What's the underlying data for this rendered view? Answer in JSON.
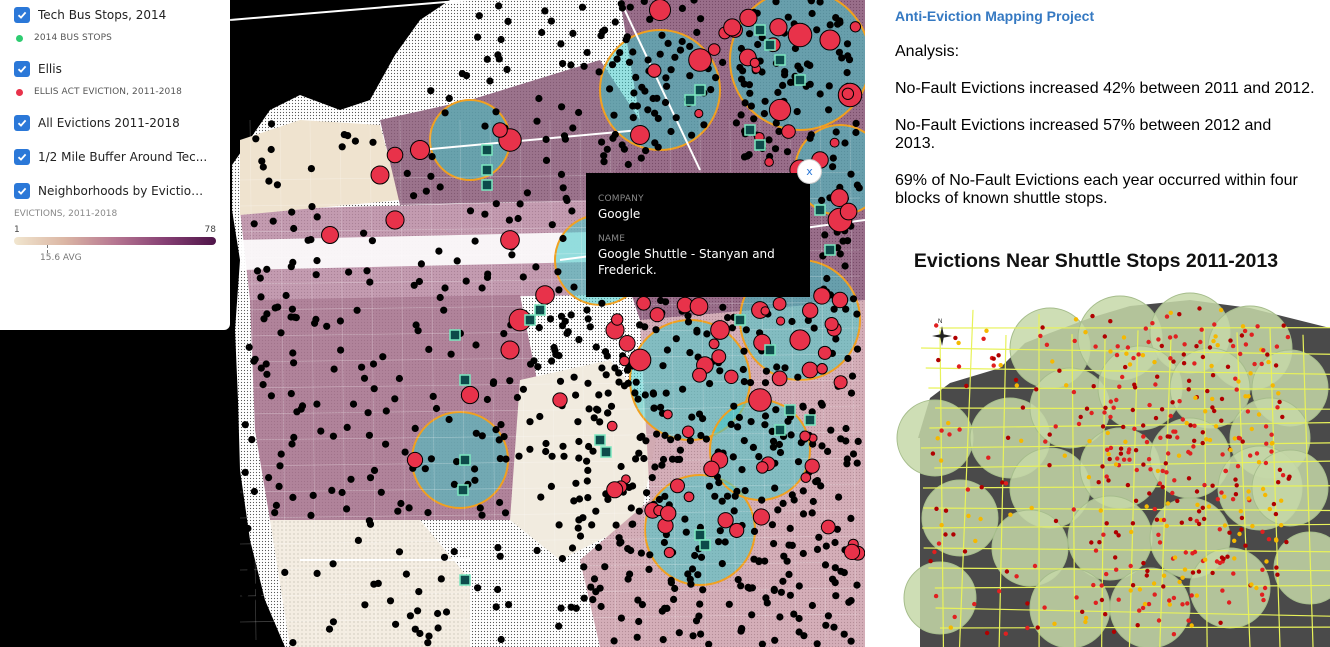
{
  "legend": {
    "layers": [
      {
        "label": "Tech Bus Stops, 2014",
        "checked": true,
        "sublabel": "2014 BUS STOPS",
        "swatch": "#2ecc71"
      },
      {
        "label": "Ellis",
        "checked": true,
        "sublabel": "ELLIS ACT EVICTION, 2011-2018",
        "swatch": "#e8324a"
      },
      {
        "label": "All Evictions 2011-2018",
        "checked": true
      },
      {
        "label": "1/2 Mile Buffer Around Tec...",
        "checked": true
      },
      {
        "label": "Neighborhoods by Eviction ...",
        "checked": true
      }
    ],
    "ramp": {
      "title": "EVICTIONS, 2011-2018",
      "min": "1",
      "max": "78",
      "avg_label": "15.6 AVG"
    }
  },
  "popup": {
    "fields": [
      {
        "key": "COMPANY",
        "value": "Google"
      },
      {
        "key": "NAME",
        "value": "Google Shuttle - Stanyan and Frederick."
      }
    ],
    "close_label": "x"
  },
  "side": {
    "link": "Anti-Eviction Mapping Project",
    "analysis": "Analysis:",
    "paragraphs": [
      "No-Fault Evictions increased 42% between 2011 and 2012.",
      "No-Fault Evictions increased 57% between 2012 and 2013.",
      "69% of No-Fault Evictions each year occurred within four blocks of known shuttle stops."
    ],
    "figure_title": "Evictions Near Shuttle Stops 2011-2013",
    "compass_label": "N"
  },
  "colors": {
    "checkbox": "#2b78d8",
    "bus_stop": "#2ecc71",
    "ellis": "#e8324a",
    "eviction": "#000000",
    "buffer": "#3fc9c9",
    "buffer_outline": "#f0a020",
    "link": "#3579c2"
  }
}
